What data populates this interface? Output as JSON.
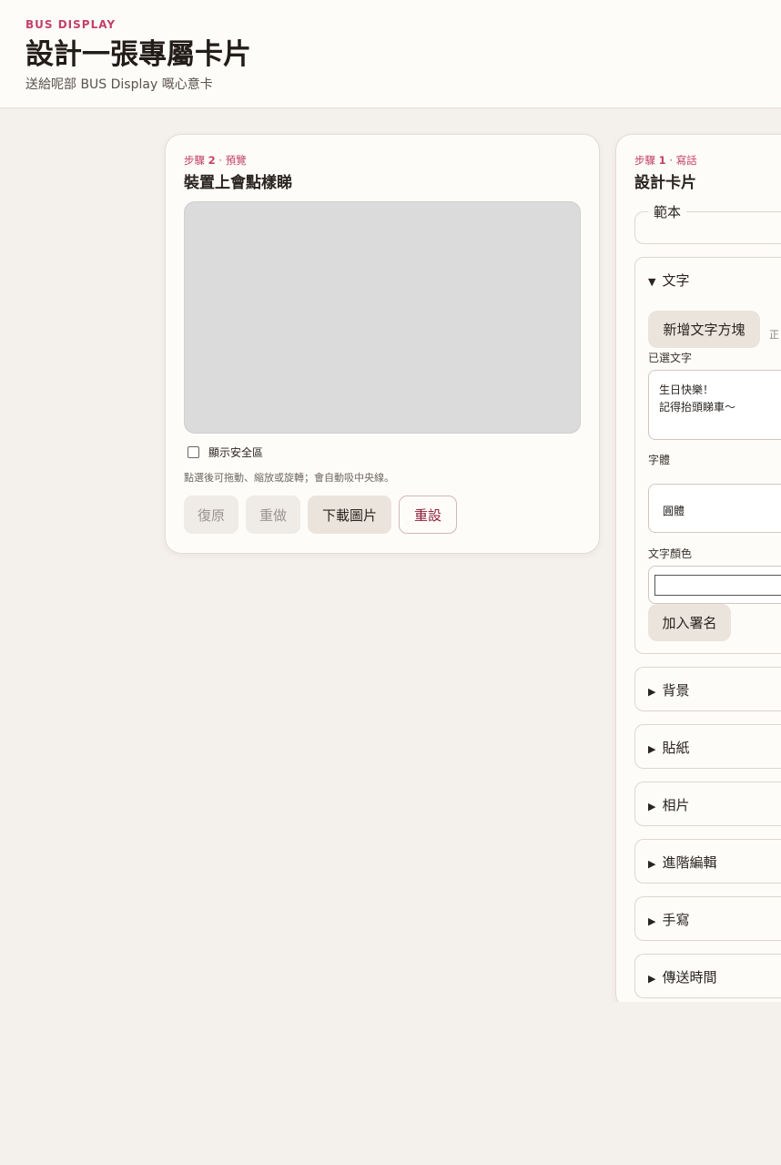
{
  "header": {
    "brand": "BUS DISPLAY",
    "title": "設計一張專屬卡片",
    "subtitle": "送給呢部 BUS Display 嘅心意卡"
  },
  "preview": {
    "step_prefix": "步驟",
    "step_num": "2",
    "step_sep": "·",
    "step_name": "預覽",
    "title": "裝置上會點樣睇",
    "safe_zone_label": "顯示安全區",
    "safe_zone_checked": false,
    "hint": "點選後可拖動、縮放或旋轉；會自動吸中央線。",
    "buttons": {
      "undo": "復原",
      "redo": "重做",
      "download": "下載圖片",
      "reset": "重設"
    }
  },
  "editor": {
    "step_prefix": "步驟",
    "step_num": "1",
    "step_sep": "·",
    "step_name": "寫話",
    "title": "設計卡片",
    "template_legend": "範本",
    "text_section": {
      "arrow": "▼",
      "label": "文字",
      "add_button": "新增文字方塊",
      "add_hint": "正",
      "selected_label": "已選文字",
      "textarea_lines": [
        "生日快樂！",
        "記得抬頭睇車～"
      ],
      "font_label": "字體",
      "font_value": "圓體",
      "color_label": "文字顏色",
      "color_value": "#ffffff",
      "signature_button": "加入署名"
    },
    "sections": [
      {
        "arrow": "▶",
        "label": "背景"
      },
      {
        "arrow": "▶",
        "label": "貼紙"
      },
      {
        "arrow": "▶",
        "label": "相片"
      },
      {
        "arrow": "▶",
        "label": "進階編輯"
      },
      {
        "arrow": "▶",
        "label": "手寫"
      },
      {
        "arrow": "▶",
        "label": "傳送時間"
      }
    ]
  },
  "colors": {
    "accent": "#c4406a",
    "page_bg": "#f4f0eb",
    "card_bg": "#fdfcf9",
    "danger": "#8f1f3a",
    "canvas_bg": "#dbdbdb"
  }
}
